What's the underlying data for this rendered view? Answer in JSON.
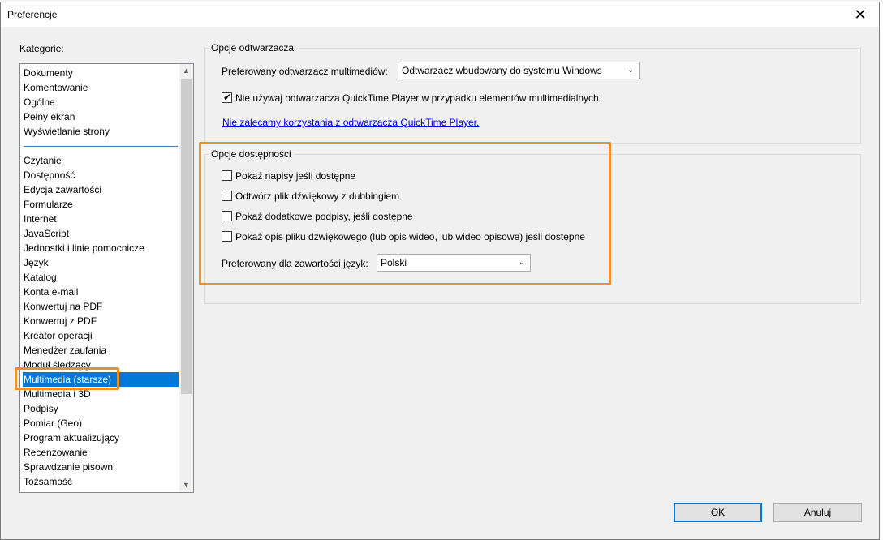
{
  "dialog": {
    "title": "Preferencje",
    "close_glyph": "✕"
  },
  "categories": {
    "label": "Kategorie:",
    "group1": [
      "Dokumenty",
      "Komentowanie",
      "Ogólne",
      "Pełny ekran",
      "Wyświetlanie strony"
    ],
    "group2": [
      "Czytanie",
      "Dostępność",
      "Edycja zawartości",
      "Formularze",
      "Internet",
      "JavaScript",
      "Jednostki i linie pomocnicze",
      "Język",
      "Katalog",
      "Konta e-mail",
      "Konwertuj na PDF",
      "Konwertuj z PDF",
      "Kreator operacji",
      "Menedżer zaufania",
      "Moduł śledzący",
      "Multimedia (starsze)",
      "Multimedia i 3D",
      "Podpisy",
      "Pomiar (Geo)",
      "Program aktualizujący",
      "Recenzowanie",
      "Sprawdzanie pisowni",
      "Tożsamość"
    ],
    "selected": "Multimedia (starsze)",
    "scroll_up": "▲",
    "scroll_down": "▼"
  },
  "player_options": {
    "legend": "Opcje odtwarzacza",
    "preferred_player_label": "Preferowany odtwarzacz multimediów:",
    "preferred_player_value": "Odtwarzacz wbudowany do systemu Windows",
    "quicktime_checkbox_label": "Nie używaj odtwarzacza QuickTime Player w przypadku elementów multimedialnych.",
    "quicktime_checked": true,
    "quicktime_link": "Nie zalecamy korzystania z odtwarzacza QuickTime Player."
  },
  "accessibility_options": {
    "legend": "Opcje dostępności",
    "checkboxes": [
      {
        "label": "Pokaż napisy jeśli dostępne",
        "checked": false
      },
      {
        "label": "Odtwórz plik dźwiękowy z dubbingiem",
        "checked": false
      },
      {
        "label": "Pokaż dodatkowe podpisy, jeśli dostępne",
        "checked": false
      },
      {
        "label": "Pokaż opis pliku dźwiękowego (lub opis wideo, lub wideo opisowe) jeśli dostępne",
        "checked": false
      }
    ],
    "language_label": "Preferowany dla zawartości  język:",
    "language_value": "Polski"
  },
  "buttons": {
    "ok": "OK",
    "cancel": "Anuluj"
  },
  "icons": {
    "dropdown": "chevron-down-icon",
    "checkmark": "checkmark-icon",
    "close": "close-icon"
  },
  "colors": {
    "highlight": "#e8912d",
    "selection": "#0078d7",
    "link": "#0000ee"
  }
}
